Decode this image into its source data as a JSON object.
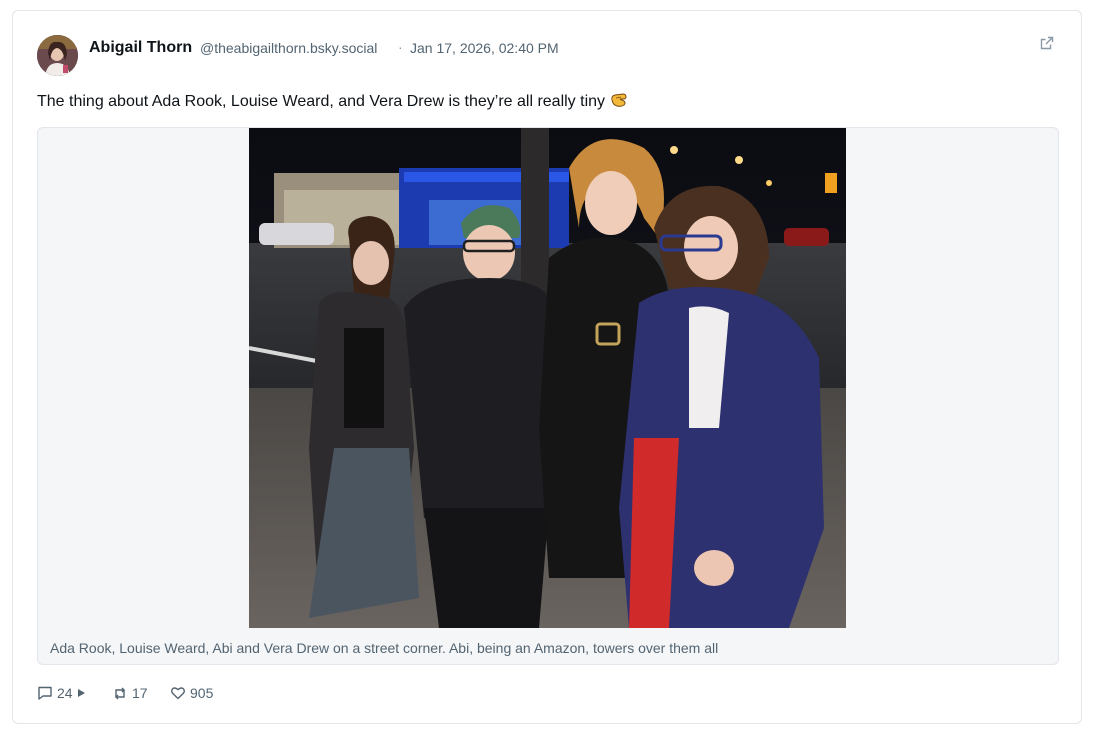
{
  "post": {
    "author_name": "Abigail Thorn",
    "author_handle": "@theabigailthorn.bsky.social",
    "separator": "·",
    "timestamp": "Jan 17, 2026, 02:40 PM",
    "text": "The thing about Ada Rook, Louise Weard, and Vera Drew is they’re all really tiny",
    "text_emoji": "pinching-hand-emoji"
  },
  "media": {
    "caption": "Ada Rook, Louise Weard, Abi and Vera Drew on a street corner. Abi, being an Amazon, towers over them all"
  },
  "actions": {
    "replies": "24",
    "reposts": "17",
    "likes": "905"
  },
  "icons": {
    "external": "external-link-icon",
    "reply": "comment-icon",
    "expand": "play-triangle-icon",
    "repost": "repost-icon",
    "like": "heart-icon"
  },
  "colors": {
    "text": "#0f1419",
    "muted": "#536471",
    "border": "#e3e6ea",
    "media_bg": "#f4f6f8"
  }
}
